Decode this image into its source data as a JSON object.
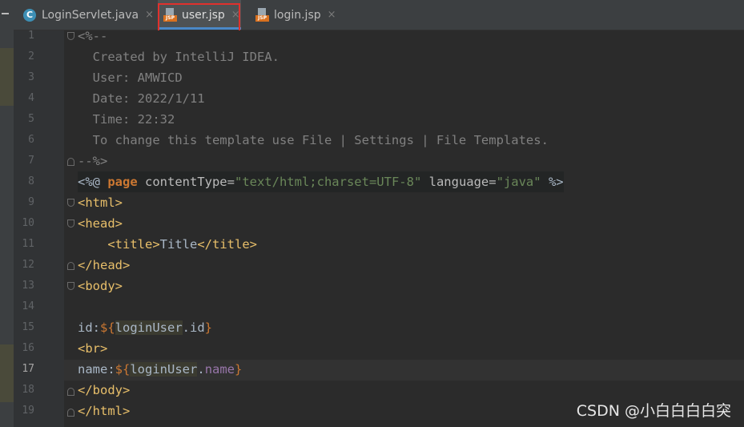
{
  "tabs": [
    {
      "label": "LoginServlet.java",
      "icon": "java-class-icon",
      "active": false
    },
    {
      "label": "user.jsp",
      "icon": "jsp-file-icon",
      "active": true
    },
    {
      "label": "login.jsp",
      "icon": "jsp-file-icon",
      "active": false
    }
  ],
  "tab_close_glyph": "×",
  "jsp_badge": "JSP",
  "class_badge": "C",
  "editor": {
    "current_line": 17,
    "line_numbers": [
      "1",
      "2",
      "3",
      "4",
      "5",
      "6",
      "7",
      "8",
      "9",
      "10",
      "11",
      "12",
      "13",
      "14",
      "15",
      "16",
      "17",
      "18",
      "19"
    ],
    "lines": {
      "l1": {
        "a": "<%--"
      },
      "l2": {
        "a": "  Created by IntelliJ IDEA."
      },
      "l3": {
        "a": "  User: AMWICD"
      },
      "l4": {
        "a": "  Date: 2022/1/11"
      },
      "l5": {
        "a": "  Time: 22:32"
      },
      "l6": {
        "a": "  To change this template use File | Settings | File Templates."
      },
      "l7": {
        "a": "--%>"
      },
      "l8": {
        "a": "<%@ ",
        "b": "page",
        "c": " contentType=",
        "d": "\"text/html;charset=UTF-8\"",
        "e": " language=",
        "f": "\"java\"",
        "g": " %>"
      },
      "l9": {
        "a": "<html>"
      },
      "l10": {
        "a": "<head>"
      },
      "l11": {
        "a": "    ",
        "b": "<title>",
        "c": "Title",
        "d": "</title>"
      },
      "l12": {
        "a": "</head>"
      },
      "l13": {
        "a": "<body>"
      },
      "l14": {
        "a": ""
      },
      "l15": {
        "a": "id:",
        "b": "${",
        "c": "loginUser",
        "d": ".id",
        "e": "}"
      },
      "l16": {
        "a": "<br>"
      },
      "l17": {
        "a": "name:",
        "b": "${",
        "c": "loginUser",
        "d": ".",
        "e": "name",
        "f": "}"
      },
      "l18": {
        "a": "</body>"
      },
      "l19": {
        "a": "</html>"
      }
    }
  },
  "colors": {
    "background": "#2b2b2b",
    "comment": "#808080",
    "tag": "#e8bf6a",
    "keyword": "#cc7832",
    "string": "#6a8759",
    "active_tab_underline": "#4a88c7",
    "annotation_box": "#e0312d"
  },
  "watermark": "CSDN @小白白白白突"
}
